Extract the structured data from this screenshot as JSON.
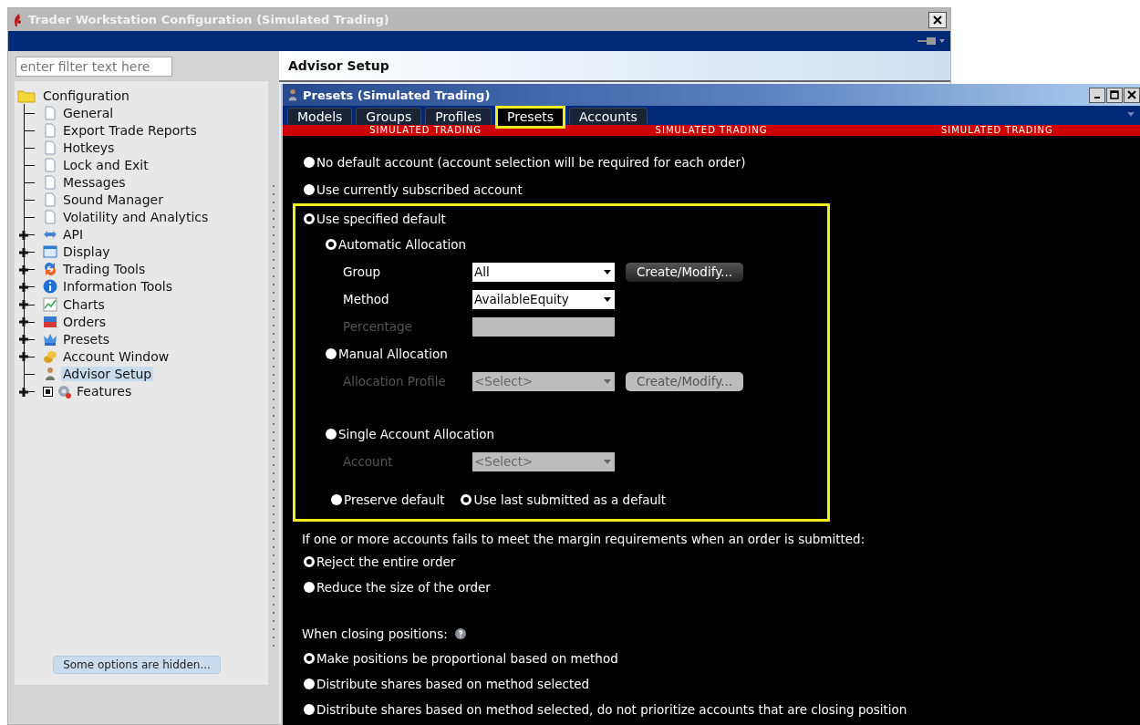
{
  "window": {
    "title": "Trader Workstation Configuration (Simulated Trading)"
  },
  "filter": {
    "placeholder": "enter filter text here"
  },
  "tree": {
    "label": "Configuration",
    "children": [
      {
        "label": "General",
        "expandable": false,
        "selected": false
      },
      {
        "label": "Export Trade Reports",
        "expandable": false,
        "selected": false
      },
      {
        "label": "Hotkeys",
        "expandable": false,
        "selected": false
      },
      {
        "label": "Lock and Exit",
        "expandable": false,
        "selected": false
      },
      {
        "label": "Messages",
        "expandable": false,
        "selected": false
      },
      {
        "label": "Sound Manager",
        "expandable": false,
        "selected": false
      },
      {
        "label": "Volatility and Analytics",
        "expandable": false,
        "selected": false
      },
      {
        "label": "API",
        "expandable": true,
        "selected": false
      },
      {
        "label": "Display",
        "expandable": true,
        "selected": false
      },
      {
        "label": "Trading Tools",
        "expandable": true,
        "selected": false
      },
      {
        "label": "Information Tools",
        "expandable": true,
        "selected": false
      },
      {
        "label": "Charts",
        "expandable": true,
        "selected": false
      },
      {
        "label": "Orders",
        "expandable": true,
        "selected": false
      },
      {
        "label": "Presets",
        "expandable": true,
        "selected": false
      },
      {
        "label": "Account Window",
        "expandable": true,
        "selected": false
      },
      {
        "label": "Advisor Setup",
        "expandable": false,
        "selected": true
      },
      {
        "label": "Features",
        "expandable": true,
        "selected": false,
        "checked": true
      }
    ]
  },
  "hidden_options_button": "Some options are hidden...",
  "panel_title": "Advisor Setup",
  "presets_window": {
    "title": "Presets (Simulated Trading)",
    "tabs": [
      {
        "label": "Models",
        "selected": false
      },
      {
        "label": "Groups",
        "selected": false
      },
      {
        "label": "Profiles",
        "selected": false
      },
      {
        "label": "Presets",
        "selected": true
      },
      {
        "label": "Accounts",
        "selected": false
      }
    ],
    "banners": [
      "SIMULATED TRADING",
      "SIMULATED TRADING",
      "SIMULATED TRADING"
    ],
    "default_account_options": [
      {
        "label": "No default account (account selection will be required for each order)",
        "selected": false
      },
      {
        "label": "Use currently subscribed account",
        "selected": false
      },
      {
        "label": "Use specified default",
        "selected": true
      }
    ],
    "allocation_options": [
      {
        "label": "Automatic Allocation",
        "selected": true,
        "fields": [
          {
            "label": "Group",
            "kind": "dropdown",
            "value": "All",
            "disabled": false,
            "button": {
              "label": "Create/Modify...",
              "disabled": false
            }
          },
          {
            "label": "Method",
            "kind": "dropdown",
            "value": "AvailableEquity",
            "disabled": false
          },
          {
            "label": "Percentage",
            "kind": "text",
            "disabled": true
          }
        ]
      },
      {
        "label": "Manual Allocation",
        "selected": false,
        "fields": [
          {
            "label": "Allocation Profile",
            "kind": "dropdown",
            "value": "<Select>",
            "disabled": true,
            "button": {
              "label": "Create/Modify...",
              "disabled": true
            }
          }
        ]
      },
      {
        "label": "Single Account Allocation",
        "selected": false,
        "fields": [
          {
            "label": "Account",
            "kind": "dropdown",
            "value": "<Select>",
            "disabled": true
          }
        ]
      }
    ],
    "default_behavior": [
      {
        "label": "Preserve default",
        "selected": false
      },
      {
        "label": "Use last submitted as a default",
        "selected": true
      }
    ],
    "margin": {
      "question": "If one or more accounts fails to meet the margin requirements when an order is submitted:",
      "options": [
        {
          "label": "Reject the entire order",
          "selected": true
        },
        {
          "label": "Reduce the size of the order",
          "selected": false
        }
      ]
    },
    "closing": {
      "label": "When closing positions:",
      "options": [
        {
          "label": "Make positions be proportional based on method",
          "selected": true
        },
        {
          "label": "Distribute shares based on method selected",
          "selected": false
        },
        {
          "label": "Distribute shares based on method selected, do not prioritize accounts that are closing position",
          "selected": false
        }
      ]
    }
  }
}
